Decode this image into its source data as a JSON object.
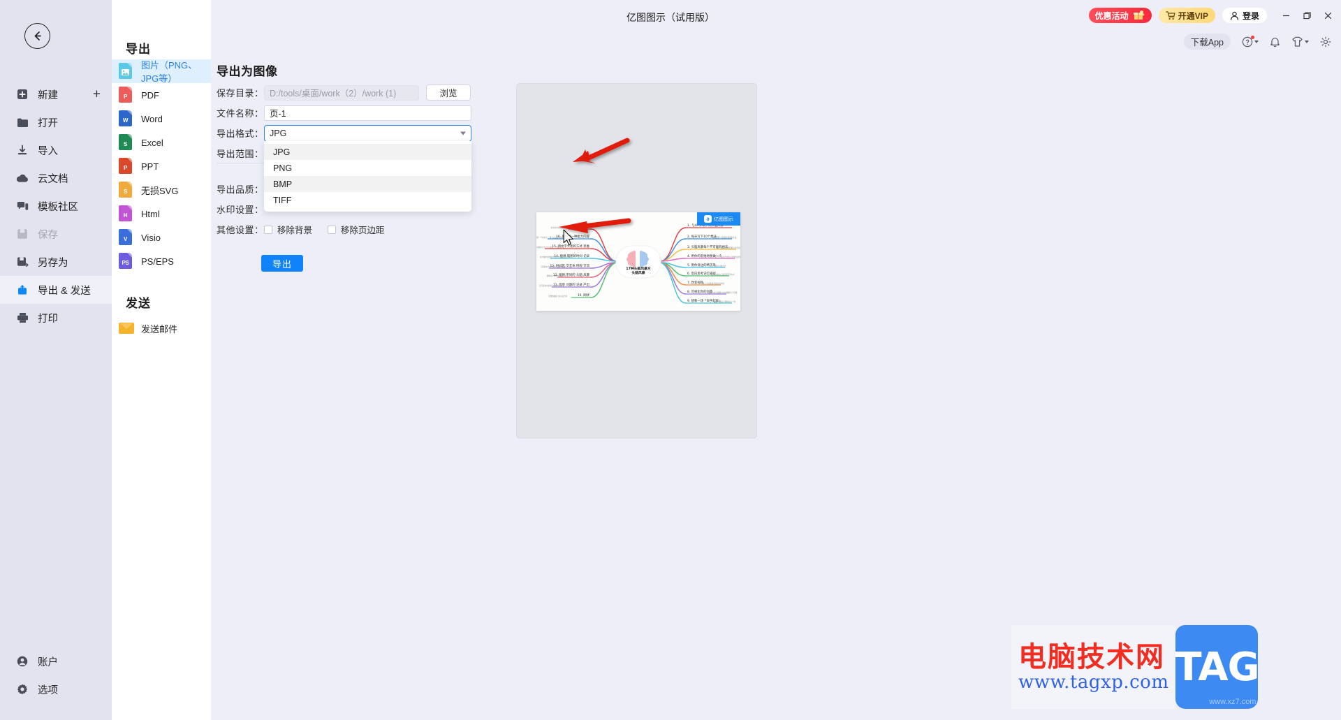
{
  "window": {
    "title": "亿图图示（试用版）",
    "controls": {
      "minimize": "minimize-icon",
      "maximize": "maximize-icon",
      "close": "close-icon"
    }
  },
  "topbar": {
    "promo_label": "优惠活动",
    "vip_label": "开通VIP",
    "login_label": "登录",
    "download_app_label": "下载App",
    "help_icon": "help-icon",
    "bell_icon": "notification-icon",
    "shirt_icon": "theme-icon",
    "gear_icon": "settings-icon"
  },
  "left_rail": {
    "back_icon": "back-arrow-icon",
    "items": [
      {
        "label": "新建",
        "icon": "new-file-icon",
        "state": "normal",
        "trailing": "+"
      },
      {
        "label": "打开",
        "icon": "folder-icon",
        "state": "normal"
      },
      {
        "label": "导入",
        "icon": "import-icon",
        "state": "normal"
      },
      {
        "label": "云文档",
        "icon": "cloud-icon",
        "state": "normal"
      },
      {
        "label": "模板社区",
        "icon": "community-icon",
        "state": "normal"
      },
      {
        "label": "保存",
        "icon": "save-icon",
        "state": "disabled"
      },
      {
        "label": "另存为",
        "icon": "save-as-icon",
        "state": "normal"
      },
      {
        "label": "导出 & 发送",
        "icon": "export-send-icon",
        "state": "active"
      },
      {
        "label": "打印",
        "icon": "print-icon",
        "state": "normal"
      }
    ],
    "bottom_items": [
      {
        "label": "账户",
        "icon": "account-icon"
      },
      {
        "label": "选项",
        "icon": "options-icon"
      }
    ]
  },
  "format_column": {
    "export_heading": "导出",
    "items": [
      {
        "label": "图片（PNG、JPG等）",
        "icon": "image-file-icon",
        "badge": "",
        "color": "#5cc8e8",
        "active": true
      },
      {
        "label": "PDF",
        "icon": "pdf-file-icon",
        "badge": "P",
        "color": "#ee5b5b",
        "active": false
      },
      {
        "label": "Word",
        "icon": "word-file-icon",
        "badge": "W",
        "color": "#2a67c8",
        "active": false
      },
      {
        "label": "Excel",
        "icon": "excel-file-icon",
        "badge": "S",
        "color": "#1f8a54",
        "active": false
      },
      {
        "label": "PPT",
        "icon": "ppt-file-icon",
        "badge": "P",
        "color": "#d9482a",
        "active": false
      },
      {
        "label": "无损SVG",
        "icon": "svg-file-icon",
        "badge": "S",
        "color": "#f0a93c",
        "active": false
      },
      {
        "label": "Html",
        "icon": "html-file-icon",
        "badge": "H",
        "color": "#c255d6",
        "active": false
      },
      {
        "label": "Visio",
        "icon": "visio-file-icon",
        "badge": "V",
        "color": "#3a6fdb",
        "active": false
      },
      {
        "label": "PS/EPS",
        "icon": "ps-file-icon",
        "badge": "PS",
        "color": "#6b5ce0",
        "active": false
      }
    ],
    "send_heading": "发送",
    "send_item": {
      "label": "发送邮件",
      "icon": "mail-icon"
    }
  },
  "panel": {
    "title": "导出为图像",
    "fields": {
      "save_dir": {
        "label": "保存目录：",
        "value": "D:/tools/桌面/work（2）/work (1)",
        "browse_label": "浏览"
      },
      "file_name": {
        "label": "文件名称：",
        "value": "页-1"
      },
      "export_format": {
        "label": "导出格式：",
        "value": "JPG"
      },
      "export_range": {
        "label": "导出范围："
      },
      "export_quality": {
        "label": "导出品质："
      },
      "watermark": {
        "label": "水印设置："
      },
      "other": {
        "label": "其他设置：",
        "checkbox_1": {
          "label": "移除背景",
          "checked": false
        },
        "checkbox_2": {
          "label": "移除页边距",
          "checked": false
        }
      }
    },
    "dropdown_options": [
      {
        "value": "JPG",
        "highlighted": true
      },
      {
        "value": "PNG",
        "highlighted": false
      },
      {
        "value": "BMP",
        "highlighted": true
      },
      {
        "value": "TIFF",
        "highlighted": false
      }
    ],
    "export_button": "导出"
  },
  "preview": {
    "badge_text": "亿图图示",
    "badge_icon": "eidraw-logo-icon",
    "mindmap": {
      "center": "17种头脑风暴方\n头脑风暴",
      "right_branches": [
        {
          "text": "1.「J.K. 罗琳」式头脑风暴",
          "color": "#e8414a"
        },
        {
          "text": "2. 每天写下10个想法",
          "color": "#3f8fe0"
        },
        {
          "text": "3. 头脑风暴每个不可能的想法",
          "color": "#f0c040"
        },
        {
          "text": "4. 用你的思维地图做一个…",
          "color": "#e268c8"
        },
        {
          "text": "5. 用你身边的椅子单",
          "color": "#44c4e8"
        },
        {
          "text": "6. 反向思考记忆捕捉",
          "color": "#52c171"
        },
        {
          "text": "7. 改变视角",
          "color": "#f09040"
        },
        {
          "text": "8. 可视化你的创意",
          "color": "#9b79e0"
        },
        {
          "text": "9. 想象一场「白手起家」",
          "color": "#45c8d4"
        }
      ],
      "left_branches": [
        {
          "text": "17. 协作创作!",
          "color": "#e8414a"
        },
        {
          "text": "16. 重复同一种能力内容",
          "color": "#3f8fe0"
        },
        {
          "text": "15. 用文字大图的方式 思维",
          "color": "#e8414a"
        },
        {
          "text": "14. 使用 脑图的时间 记录",
          "color": "#44c4e8"
        },
        {
          "text": "13. 时间区 交互体 例程 交流",
          "color": "#9b79e0"
        },
        {
          "text": "12. 使用 不同的 头脑 风暴",
          "color": "#e8657a"
        },
        {
          "text": "11. 简单 问题的 记录 产出",
          "color": "#9b79e0"
        },
        {
          "text": "10. 网状",
          "color": "#52c171"
        }
      ]
    }
  },
  "annotations": {
    "arrow_1": "points at export-format combobox",
    "arrow_2": "points at BMP dropdown option",
    "cursor": "mouse-pointer"
  },
  "watermark": {
    "site_cn": "电脑技术网",
    "site_url": "www.tagxp.com",
    "logo_text": "TAG",
    "secondary_url": "www.xz7.com"
  },
  "colors": {
    "accent_blue": "#1083fb",
    "panel_bg": "#edeef7",
    "rail_bg": "#e2e3ee",
    "active_item_bg": "#def0fd",
    "arrow_red": "#e01b10"
  }
}
